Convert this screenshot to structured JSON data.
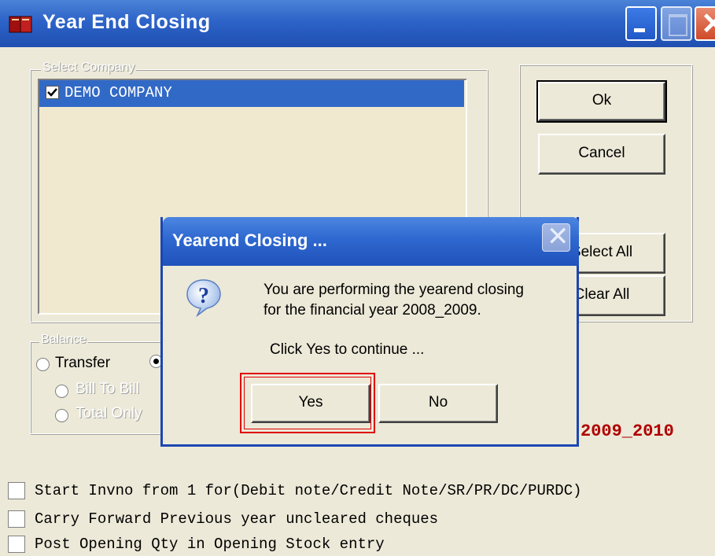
{
  "window": {
    "title": "Year End Closing"
  },
  "select_company": {
    "legend": "Select Company",
    "companies": [
      {
        "name": "DEMO COMPANY",
        "checked": true
      }
    ]
  },
  "buttons": {
    "ok": "Ok",
    "cancel": "Cancel",
    "select_all": "Select All",
    "clear_all": "Clear All"
  },
  "balance": {
    "legend": "Balance",
    "transfer": "Transfer",
    "bill_to_bill": "Bill To Bill",
    "total_only": "Total Only"
  },
  "next_year": "2009_2010",
  "options": [
    {
      "label": "Start Invno from 1 for(Debit note/Credit Note/SR/PR/DC/PURDC)",
      "checked": false
    },
    {
      "label": "Carry Forward Previous year uncleared cheques",
      "checked": false
    },
    {
      "label": "Post Opening Qty in Opening Stock entry",
      "checked": false
    }
  ],
  "dialog": {
    "title": "Yearend Closing ...",
    "line1": "You are performing the yearend closing",
    "line2": "for the financial year 2008_2009.",
    "line3": "Click Yes to continue ...",
    "yes": "Yes",
    "no": "No"
  },
  "colors": {
    "titlebar": "#2d63c8",
    "selection": "#3169c6",
    "year_text": "#b00000",
    "highlight": "#e00000"
  }
}
